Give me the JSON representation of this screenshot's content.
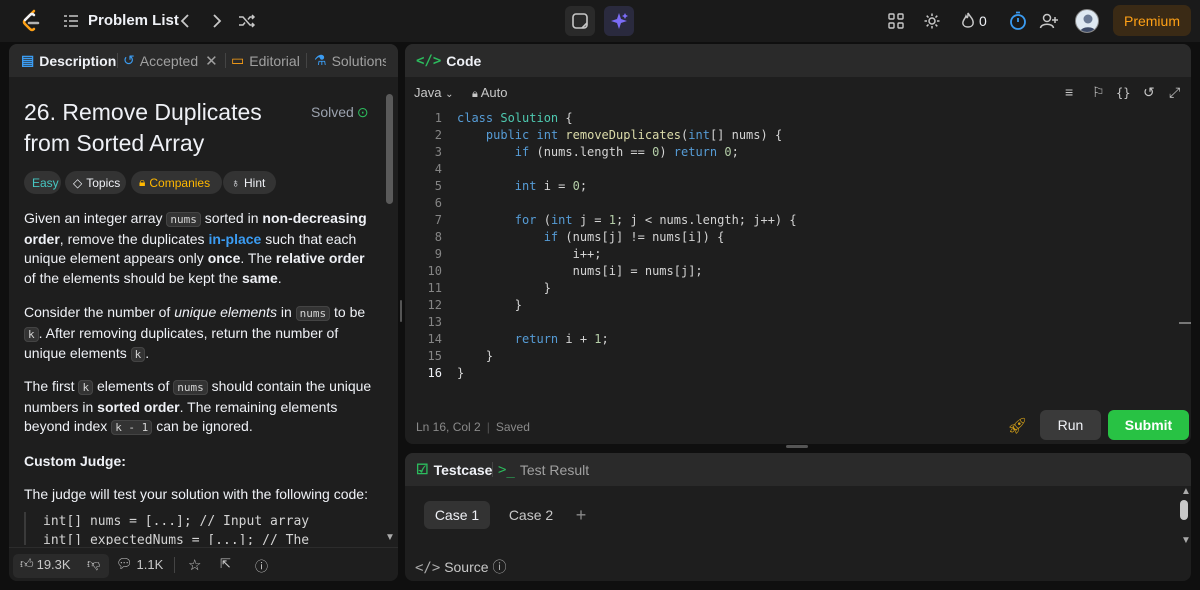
{
  "topbar": {
    "problem_list": "Problem List",
    "streak": "0",
    "premium": "Premium"
  },
  "left": {
    "tabs": [
      "Description",
      "Accepted",
      "Editorial",
      "Solutions"
    ],
    "title": "26. Remove Duplicates from Sorted Array",
    "solved": "Solved",
    "chips": {
      "easy": "Easy",
      "topics": "Topics",
      "companies": "Companies",
      "hint": "Hint"
    },
    "p1": {
      "a": "Given an integer array ",
      "code1": "nums",
      "b": " sorted in ",
      "b1": "non-decreasing order",
      "c": ", remove the duplicates ",
      "hl": "in-place",
      "d": " such that each unique element appears only ",
      "b2": "once",
      "e": ". The ",
      "b3": "relative order",
      "f": " of the elements should be kept the ",
      "b4": "same",
      "g": "."
    },
    "p2": {
      "a": "Consider the number of ",
      "i1": "unique elements",
      "b": " in ",
      "code1": "nums",
      "c": " to be ",
      "code2": "k",
      "d": ". After removing duplicates, return the number of unique elements ",
      "code3": "k",
      "e": "."
    },
    "p3": {
      "a": "The first ",
      "code1": "k",
      "b": " elements of ",
      "code2": "nums",
      "c": " should contain the unique numbers in ",
      "b1": "sorted order",
      "d": ". The remaining elements beyond index ",
      "code3": "k - 1",
      "e": " can be ignored."
    },
    "judge_head": "Custom Judge:",
    "judge_text": "The judge will test your solution with the following code:",
    "judge_code": [
      "int[] nums = [...]; // Input array",
      "int[] expectedNums = [...]; // The"
    ],
    "footer": {
      "likes": "19.3K",
      "comments": "1.1K"
    }
  },
  "code": {
    "tab": "Code",
    "language": "Java",
    "auto": "Auto",
    "lines": [
      "class Solution {",
      "    public int removeDuplicates(int[] nums) {",
      "        if (nums.length == 0) return 0;",
      "",
      "        int i = 0;",
      "",
      "        for (int j = 1; j < nums.length; j++) {",
      "            if (nums[j] != nums[i]) {",
      "                i++;",
      "                nums[i] = nums[j];",
      "            }",
      "        }",
      "",
      "        return i + 1;",
      "    }",
      "}"
    ],
    "line_numbers": [
      "1",
      "2",
      "3",
      "4",
      "5",
      "6",
      "7",
      "8",
      "9",
      "10",
      "11",
      "12",
      "13",
      "14",
      "15",
      "16"
    ],
    "status_pos": "Ln 16, Col 2",
    "status_saved": "Saved",
    "run": "Run",
    "submit": "Submit"
  },
  "test": {
    "tabs": [
      "Testcase",
      "Test Result"
    ],
    "cases": [
      "Case 1",
      "Case 2"
    ],
    "add": "+",
    "source": "Source"
  },
  "colors": {
    "accent": "#ffa116",
    "submit": "#28c244",
    "easy": "#46c6c2",
    "link": "#3b9cf2"
  }
}
